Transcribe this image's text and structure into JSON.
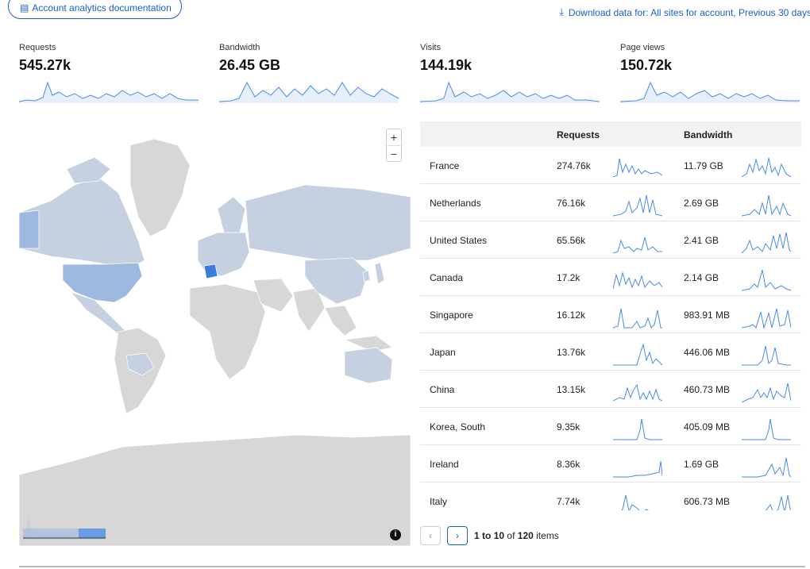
{
  "header": {
    "doc_link": "Account analytics documentation",
    "download_link": "Download data for: All sites for account, Previous 30 days"
  },
  "stats": [
    {
      "label": "Requests",
      "value": "545.27k"
    },
    {
      "label": "Bandwidth",
      "value": "26.45 GB"
    },
    {
      "label": "Visits",
      "value": "144.19k"
    },
    {
      "label": "Page views",
      "value": "150.72k"
    }
  ],
  "map": {
    "zoom_in": "+",
    "zoom_out": "−",
    "info": "i",
    "colors": {
      "base": "#d7d7d7",
      "low": "#c5d0e0",
      "mid": "#9fb8e0",
      "high": "#3b7ddd",
      "ocean": "#ffffff"
    }
  },
  "table": {
    "headers": {
      "country": "",
      "requests": "Requests",
      "bandwidth": "Bandwidth"
    },
    "rows": [
      {
        "country": "France",
        "requests": "274.76k",
        "bandwidth": "11.79 GB"
      },
      {
        "country": "Netherlands",
        "requests": "76.16k",
        "bandwidth": "2.69 GB"
      },
      {
        "country": "United States",
        "requests": "65.56k",
        "bandwidth": "2.41 GB"
      },
      {
        "country": "Canada",
        "requests": "17.2k",
        "bandwidth": "2.14 GB"
      },
      {
        "country": "Singapore",
        "requests": "16.12k",
        "bandwidth": "983.91 MB"
      },
      {
        "country": "Japan",
        "requests": "13.76k",
        "bandwidth": "446.06 MB"
      },
      {
        "country": "China",
        "requests": "13.15k",
        "bandwidth": "460.73 MB"
      },
      {
        "country": "Korea, South",
        "requests": "9.35k",
        "bandwidth": "405.09 MB"
      },
      {
        "country": "Ireland",
        "requests": "8.36k",
        "bandwidth": "1.69 GB"
      },
      {
        "country": "Italy",
        "requests": "7.74k",
        "bandwidth": "606.73 MB"
      }
    ]
  },
  "pager": {
    "prev": "‹",
    "next": "›",
    "range_from": "1",
    "range_to": "10",
    "total": "120",
    "to_word": "to",
    "of_word": "of",
    "items_word": "items"
  },
  "icons": {
    "doc": "document-icon",
    "download": "download-icon",
    "info": "info-icon",
    "prev": "chevron-left-icon",
    "next": "chevron-right-icon"
  },
  "accent": "#1a5fd0",
  "spark_color": "#4a8ae8"
}
